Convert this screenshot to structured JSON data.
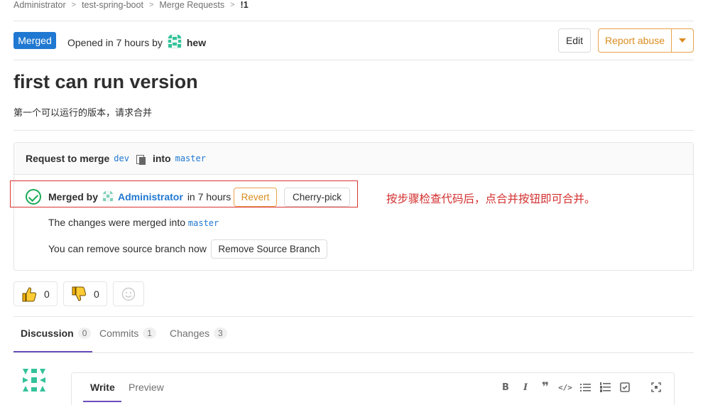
{
  "breadcrumb": [
    "Administrator",
    "test-spring-boot",
    "Merge Requests",
    "!1"
  ],
  "header": {
    "status": "Merged",
    "opened_text": "Opened in 7 hours by",
    "author": "hew",
    "edit_label": "Edit",
    "report_label": "Report abuse"
  },
  "mr": {
    "title": "first can run version",
    "description": "第一个可以运行的版本，请求合并"
  },
  "widget": {
    "request_label": "Request to merge",
    "source_branch": "dev",
    "into_label": "into",
    "target_branch": "master",
    "merged_by_label": "Merged by",
    "merged_by_user": "Administrator",
    "merged_time": "in 7 hours",
    "revert_label": "Revert",
    "cherry_pick_label": "Cherry-pick",
    "changes_text": "The changes were merged into",
    "changes_branch": "master",
    "remove_text": "You can remove source branch now",
    "remove_button": "Remove Source Branch"
  },
  "annotation": "按步骤检查代码后，点合并按钮即可合并。",
  "awards": {
    "thumbs_up": "0",
    "thumbs_down": "0"
  },
  "tabs": [
    {
      "label": "Discussion",
      "count": "0"
    },
    {
      "label": "Commits",
      "count": "1"
    },
    {
      "label": "Changes",
      "count": "3"
    }
  ],
  "comment": {
    "write_label": "Write",
    "preview_label": "Preview"
  },
  "toolbar_icons": [
    "bold-icon",
    "italic-icon",
    "quote-icon",
    "code-icon",
    "bullet-list-icon",
    "numbered-list-icon",
    "task-list-icon",
    "fullscreen-icon"
  ],
  "colors": {
    "accent": "#1f78d1",
    "merged_green": "#1aaa55",
    "warning": "#db8d1f",
    "annotation_red": "#d32f2f",
    "tab_active": "#6b4fbb"
  }
}
